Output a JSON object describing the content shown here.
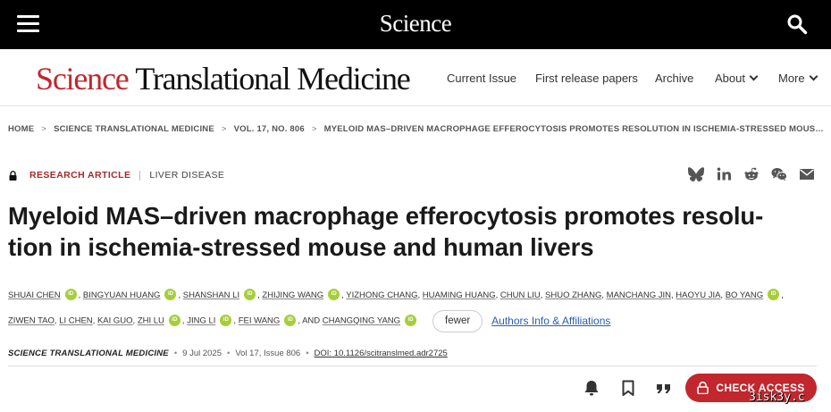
{
  "site": {
    "logo": "Science",
    "menu_icon": "hamburger-menu-icon",
    "search_icon": "search-icon"
  },
  "journal": {
    "logo_science": "Science",
    "logo_rest": "Translational Medicine",
    "nav": [
      "Current Issue",
      "First release papers",
      "Archive",
      "About",
      "More"
    ]
  },
  "breadcrumb": [
    "HOME",
    "SCIENCE TRANSLATIONAL MEDICINE",
    "VOL. 17, NO. 806",
    "MYELOID MAS–DRIVEN MACROPHAGE EFFEROCYTOSIS PROMOTES RESOLUTION IN ISCHEMIA-STRESSED MOUS…"
  ],
  "article": {
    "type": "RESEARCH ARTICLE",
    "subject": "LIVER DISEASE",
    "title_line1": "Myeloid MAS–driven macrophage efferocytosis promotes resolu-",
    "title_line2": "tion in ischemia-stressed mouse and human livers",
    "authors": {
      "a0": "SHUAI CHEN",
      "a1": "BINGYUAN HUANG",
      "a2": "SHANSHAN LI",
      "a3": "ZHIJING WANG",
      "a4": "YIZHONG CHANG",
      "a5": "HUAMING HUANG",
      "a6": "CHUN LIU",
      "a7": "SHUO ZHANG",
      "a8": "MANCHANG JIN",
      "a9": "HAOYU JIA",
      "a10": "BO YANG",
      "a11": "ZIWEN TAO",
      "a12": "LI CHEN",
      "a13": "KAI GUO",
      "a14": "ZHI LU",
      "a15": "JING LI",
      "a16": "FEI WANG",
      "a17": "CHANGQING YANG"
    },
    "orcid_label": "iD",
    "and_text": ", AND",
    "fewer_label": "fewer",
    "affiliations_label": "Authors Info & Affiliations",
    "journal_name": "SCIENCE TRANSLATIONAL MEDICINE",
    "date": "9 Jul 2025",
    "volume": "Vol 17, Issue 806",
    "doi": "DOI: 10.1126/scitranslmed.adr2725"
  },
  "share_icons": [
    "bluesky-icon",
    "linkedin-icon",
    "reddit-icon",
    "wechat-icon",
    "email-icon"
  ],
  "actions": {
    "check_access": "CHECK ACCESS",
    "icons": [
      "bell-icon",
      "bookmark-icon",
      "quote-icon"
    ]
  },
  "watermark": "3isk3y.c"
}
